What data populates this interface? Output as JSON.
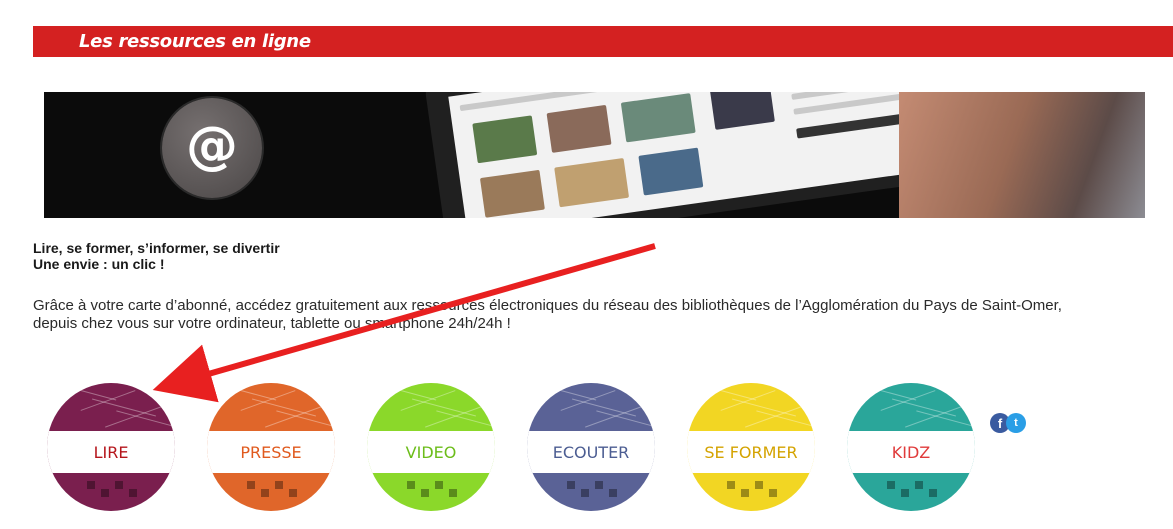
{
  "header": {
    "title": "Les ressources en ligne",
    "color": "#d42121"
  },
  "banner": {
    "symbol": "@"
  },
  "intro": {
    "line1": "Lire, se former, s’informer, se divertir",
    "line2": "Une envie : un clic !"
  },
  "description": {
    "line1": "Grâce à votre carte d’abonné, accédez gratuitement aux ressources électroniques du réseau des bibliothèques de l’Agglomération du Pays de Saint-Omer,",
    "line2": "depuis chez vous sur votre ordinateur, tablette ou smartphone 24h/24h !"
  },
  "categories": [
    {
      "label": "LIRE",
      "bg": "#7a1f4e",
      "text": "#b5161c"
    },
    {
      "label": "PRESSE",
      "bg": "#e0662a",
      "text": "#e05a1e"
    },
    {
      "label": "VIDEO",
      "bg": "#8bd82a",
      "text": "#6cbd1a"
    },
    {
      "label": "ECOUTER",
      "bg": "#5a6296",
      "text": "#4c5d92"
    },
    {
      "label": "SE FORMER",
      "bg": "#f2d623",
      "text": "#d4a300"
    },
    {
      "label": "KIDZ",
      "bg": "#2aa69a",
      "text": "#e03b3b"
    }
  ],
  "social": {
    "facebook": "facebook-icon",
    "twitter": "twitter-icon"
  },
  "annotation": {
    "arrow_color": "#e82020"
  }
}
